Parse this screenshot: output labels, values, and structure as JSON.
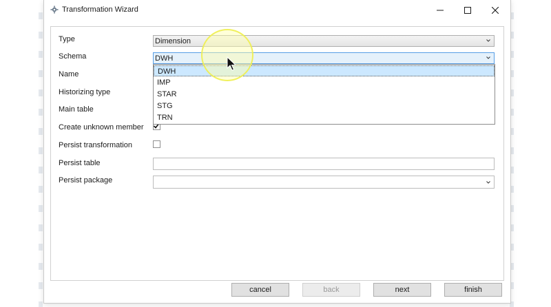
{
  "window": {
    "title": "Transformation Wizard"
  },
  "form": {
    "type_label": "Type",
    "type_value": "Dimension",
    "schema_label": "Schema",
    "schema_value": "DWH",
    "name_label": "Name",
    "historizing_label": "Historizing type",
    "main_table_label": "Main table",
    "unknown_member_label": "Create unknown member",
    "unknown_member_checked": true,
    "persist_transformation_label": "Persist transformation",
    "persist_transformation_checked": false,
    "persist_table_label": "Persist table",
    "persist_table_value": "",
    "persist_package_label": "Persist package",
    "persist_package_value": ""
  },
  "schema_dropdown": {
    "options": [
      "DWH",
      "IMP",
      "STAR",
      "STG",
      "TRN"
    ],
    "selected": "DWH"
  },
  "buttons": {
    "cancel": "cancel",
    "back": "back",
    "next": "next",
    "finish": "finish"
  },
  "colors": {
    "selection": "#cce8ff",
    "focus_border": "#569de5",
    "highlight": "#eeee50"
  }
}
